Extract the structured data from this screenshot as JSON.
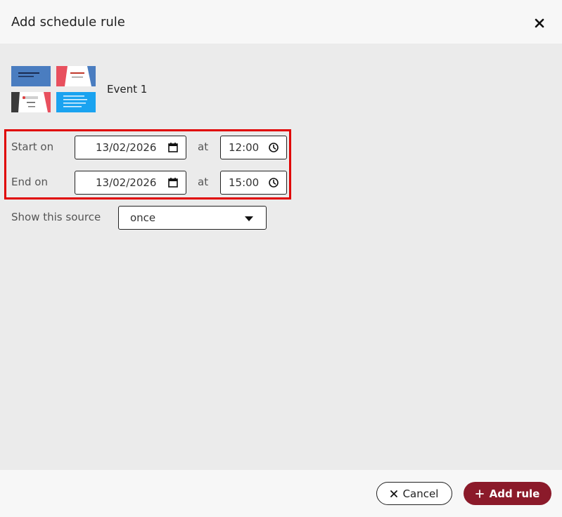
{
  "dialog": {
    "title": "Add schedule rule",
    "close_icon": "close-icon"
  },
  "event": {
    "name": "Event 1",
    "thumbnails": [
      "slide-thumbnail-1",
      "slide-thumbnail-2",
      "slide-thumbnail-3",
      "slide-thumbnail-4"
    ]
  },
  "start": {
    "label": "Start on",
    "date": "13/02/2026",
    "at": "at",
    "time": "12:00"
  },
  "end": {
    "label": "End on",
    "date": "13/02/2026",
    "at": "at",
    "time": "15:00"
  },
  "show": {
    "label": "Show this source",
    "value": "once"
  },
  "footer": {
    "cancel_label": "Cancel",
    "add_label": "Add rule"
  },
  "colors": {
    "highlight": "#e00000",
    "primary_button": "#8b1a2a",
    "body_bg": "#ebebeb",
    "header_bg": "#f7f7f7"
  }
}
